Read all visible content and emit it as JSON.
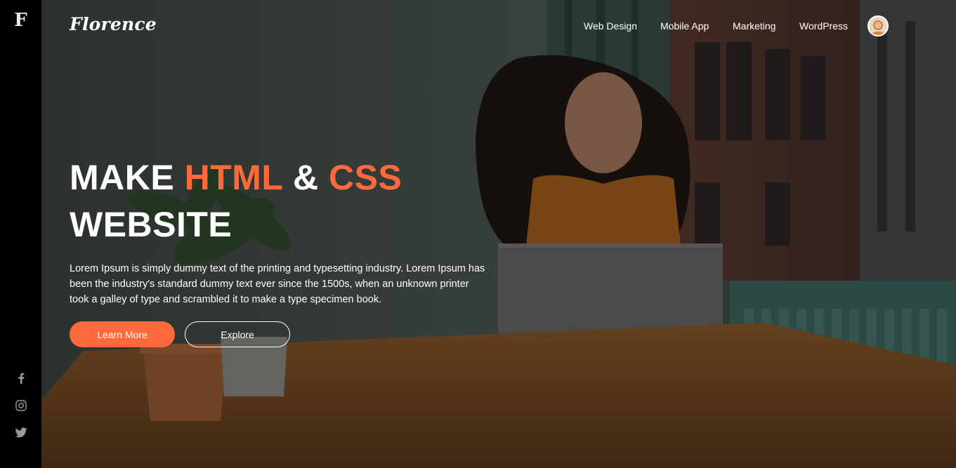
{
  "rail": {
    "logo": "F",
    "social": [
      "facebook-icon",
      "instagram-icon",
      "twitter-icon"
    ]
  },
  "header": {
    "brand": "Florence",
    "nav": [
      {
        "label": "Web Design"
      },
      {
        "label": "Mobile App"
      },
      {
        "label": "Marketing"
      },
      {
        "label": "WordPress"
      }
    ]
  },
  "hero": {
    "headline": {
      "part1": "MAKE ",
      "accent1": "HTML",
      "part2": " & ",
      "accent2": "CSS",
      "line2": "WEBSITE"
    },
    "lead": "Lorem Ipsum is simply dummy text of the printing and typesetting industry. Lorem Ipsum has been the industry's standard dummy text ever since the 1500s, when an unknown printer took a galley of type and scrambled it to make a type specimen book.",
    "buttons": {
      "primary": "Learn More",
      "secondary": "Explore"
    }
  },
  "colors": {
    "accent": "#ff6a3d",
    "rail": "#000000"
  }
}
